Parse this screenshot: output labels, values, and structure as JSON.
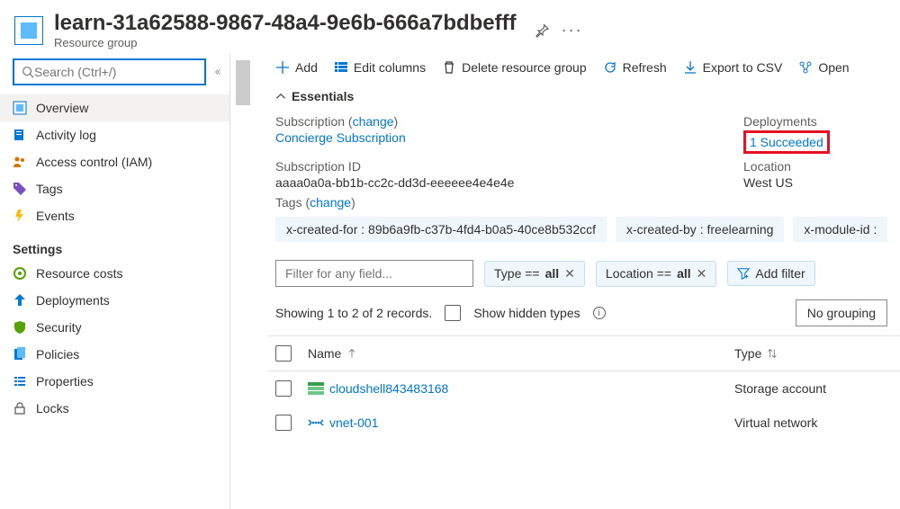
{
  "header": {
    "title": "learn-31a62588-9867-48a4-9e6b-666a7bdbefff",
    "subtitle": "Resource group"
  },
  "search": {
    "placeholder": "Search (Ctrl+/)"
  },
  "nav": {
    "items": [
      {
        "label": "Overview"
      },
      {
        "label": "Activity log"
      },
      {
        "label": "Access control (IAM)"
      },
      {
        "label": "Tags"
      },
      {
        "label": "Events"
      }
    ],
    "settingsHeading": "Settings",
    "settings": [
      {
        "label": "Resource costs"
      },
      {
        "label": "Deployments"
      },
      {
        "label": "Security"
      },
      {
        "label": "Policies"
      },
      {
        "label": "Properties"
      },
      {
        "label": "Locks"
      }
    ]
  },
  "toolbar": {
    "add": "Add",
    "editColumns": "Edit columns",
    "deleteGroup": "Delete resource group",
    "refresh": "Refresh",
    "exportCsv": "Export to CSV",
    "open": "Open"
  },
  "essentials": {
    "title": "Essentials",
    "subLabel": "Subscription (",
    "changeLink": "change",
    "closeParen": ")",
    "subValue": "Concierge Subscription",
    "subIdLabel": "Subscription ID",
    "subIdValue": "aaaa0a0a-bb1b-cc2c-dd3d-eeeeee4e4e4e",
    "tagsLabel": "Tags (",
    "deployLabel": "Deployments",
    "deployValue": "1 Succeeded",
    "locLabel": "Location",
    "locValue": "West US",
    "tagPills": [
      "x-created-for : 89b6a9fb-c37b-4fd4-b0a5-40ce8b532ccf",
      "x-created-by : freelearning",
      "x-module-id :"
    ]
  },
  "filters": {
    "placeholder": "Filter for any field...",
    "typeChip": {
      "prefix": "Type == ",
      "val": "all"
    },
    "locChip": {
      "prefix": "Location == ",
      "val": "all"
    },
    "addFilter": "Add filter"
  },
  "records": {
    "showing": "Showing 1 to 2 of 2 records.",
    "hidden": "Show hidden types",
    "noGrouping": "No grouping"
  },
  "table": {
    "nameCol": "Name",
    "typeCol": "Type",
    "rows": [
      {
        "name": "cloudshell843483168",
        "type": "Storage account"
      },
      {
        "name": "vnet-001",
        "type": "Virtual network"
      }
    ]
  }
}
